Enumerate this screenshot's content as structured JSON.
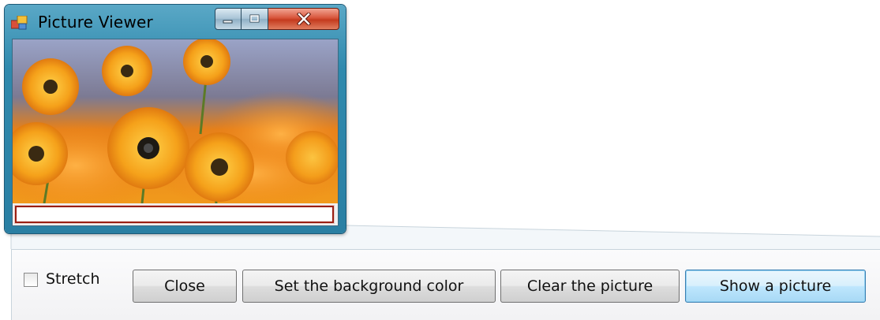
{
  "window": {
    "title": "Picture Viewer",
    "app_icon": "app-icon",
    "controls": {
      "minimize_icon": "minimize-icon",
      "maximize_icon": "maximize-icon",
      "close_icon": "close-icon"
    },
    "picture_description_icon": "flower-photo",
    "textbox_value": ""
  },
  "toolbar": {
    "stretch_checkbox": {
      "label": "Stretch",
      "checked": false
    },
    "buttons": {
      "close": "Close",
      "set_background": "Set the background color",
      "clear_picture": "Clear the picture",
      "show_picture": "Show a picture"
    }
  },
  "colors": {
    "title_bar": "#2f89ad",
    "close_button": "#c43b1e",
    "textbox_border": "#9a1e12",
    "default_button_border": "#3c7fb1"
  }
}
